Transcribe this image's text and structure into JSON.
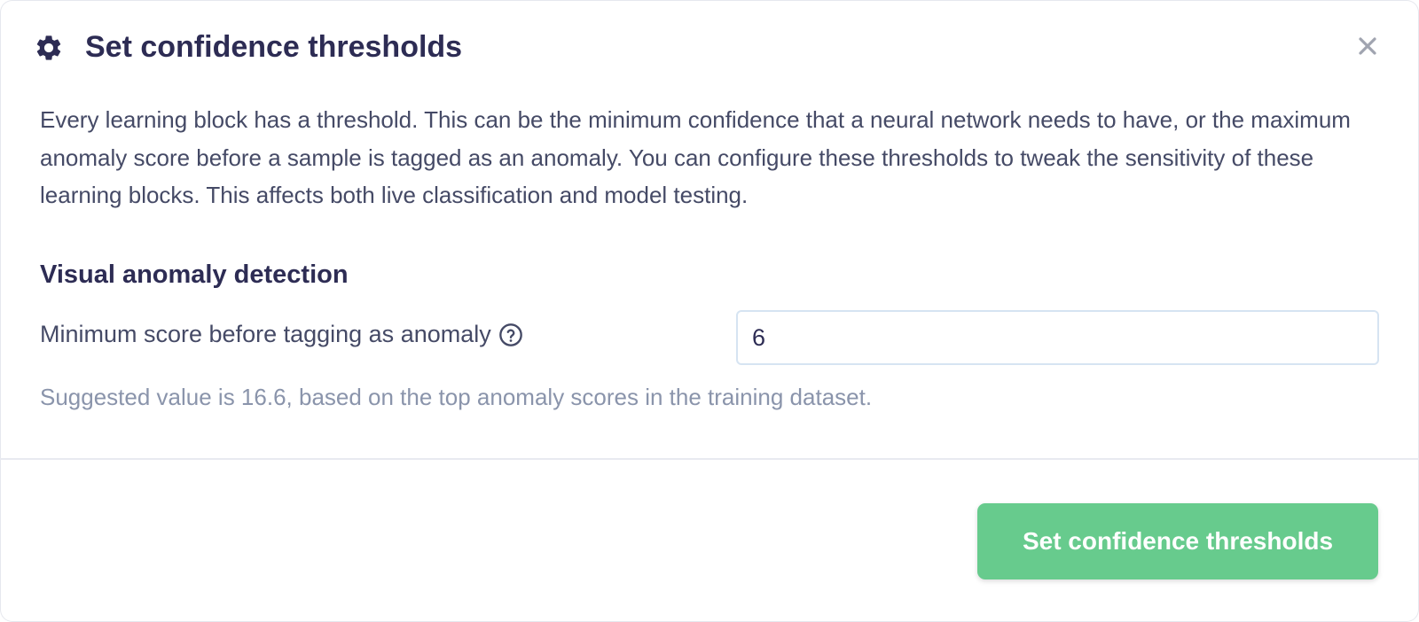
{
  "modal": {
    "title": "Set confidence thresholds",
    "title_icon": "gear-icon",
    "close_icon": "close-icon",
    "description": "Every learning block has a threshold. This can be the minimum confidence that a neural network needs to have, or the maximum anomaly score before a sample is tagged as an anomaly. You can configure these thresholds to tweak the sensitivity of these learning blocks. This affects both live classification and model testing."
  },
  "section": {
    "title": "Visual anomaly detection",
    "field_label": "Minimum score before tagging as anomaly",
    "help_icon": "question-circle-icon",
    "input_value": "6",
    "hint": "Suggested value is 16.6, based on the top anomaly scores in the training dataset."
  },
  "footer": {
    "submit_label": "Set confidence thresholds"
  },
  "colors": {
    "title": "#2d2c54",
    "body_text": "#454a66",
    "hint_text": "#8a94ab",
    "input_border": "#d6e4f2",
    "primary_button": "#67cb8d",
    "icon": "#2d2c54",
    "close_icon": "#a0a4b0"
  }
}
